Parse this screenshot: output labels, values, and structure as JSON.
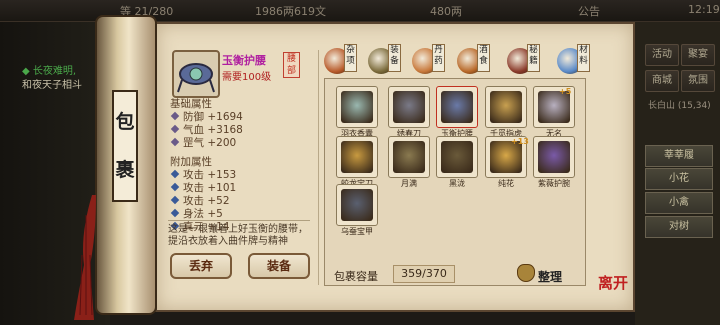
{
  "topbar": {
    "level": "等 21/280",
    "money": "1986两619文",
    "gold": "480两",
    "announce": "公告",
    "clock": "12:19"
  },
  "chat": {
    "line1": "◆ 长夜难明,",
    "line2": "和夜天子相斗"
  },
  "right_menu": {
    "activity": "活动",
    "team": "聚宴",
    "shop": "商城",
    "help": "氛围",
    "location": "长白山",
    "location_coord": "(15,34)",
    "npc1": "莘莘履",
    "npc2": "小花",
    "npc3": "小禽",
    "npc4": "对树"
  },
  "scroll_title": "包裹",
  "selected_item": {
    "name": "玉衡护腰",
    "requirement": "需要100级",
    "slot_tag": "腰部"
  },
  "base_stats_title": "基础属性",
  "base_stats": [
    {
      "label": "防御",
      "value": "+1694"
    },
    {
      "label": "气血",
      "value": "+3168"
    },
    {
      "label": "罡气",
      "value": "+200"
    }
  ],
  "extra_stats_title": "附加属性",
  "extra_stats": [
    {
      "label": "攻击",
      "value": "+153"
    },
    {
      "label": "攻击",
      "value": "+101"
    },
    {
      "label": "攻击",
      "value": "+52"
    },
    {
      "label": "身法",
      "value": "+5"
    },
    {
      "label": "真元",
      "value": "+14"
    }
  ],
  "description": "这是一根镶着上好玉衡的腰带，提沿衣放着入曲件牌与精神",
  "buttons": {
    "discard": "丢弃",
    "equip": "装备",
    "sort": "整理"
  },
  "categories": [
    {
      "label": "杂项",
      "color": "#b85a2a"
    },
    {
      "label": "装备",
      "color": "#7a6a3a"
    },
    {
      "label": "丹药",
      "color": "#c8783a"
    },
    {
      "label": "酒食",
      "color": "#b86828"
    },
    {
      "label": "秘籍",
      "color": "#8a3a2a"
    },
    {
      "label": "材料",
      "color": "#5a8ac8"
    }
  ],
  "inventory": [
    {
      "name": "羽衣香囊",
      "color": "#9ab8b0",
      "badge": ""
    },
    {
      "name": "绣春刀",
      "color": "#7a7a88",
      "badge": ""
    },
    {
      "name": "玉衡护腰",
      "color": "#6a7aa8",
      "badge": ""
    },
    {
      "name": "千觅指虎",
      "color": "#c8a050",
      "badge": ""
    },
    {
      "name": "无名",
      "color": "#b8b0c0",
      "badge": "+5"
    },
    {
      "name": "蛟龙宝刀",
      "color": "#c89a40",
      "badge": ""
    },
    {
      "name": "月满",
      "color": "#8a7a50",
      "badge": ""
    },
    {
      "name": "黑泷",
      "color": "#6a5a3a",
      "badge": ""
    },
    {
      "name": "纯花",
      "color": "#d8a848",
      "badge": "+13"
    },
    {
      "name": "紫薇护腕",
      "color": "#7a5aa8",
      "badge": ""
    },
    {
      "name": "乌蚕宝甲",
      "color": "#5a6070",
      "badge": ""
    }
  ],
  "capacity_label": "包裹容量",
  "capacity_value": "359/370",
  "logo": "离开"
}
